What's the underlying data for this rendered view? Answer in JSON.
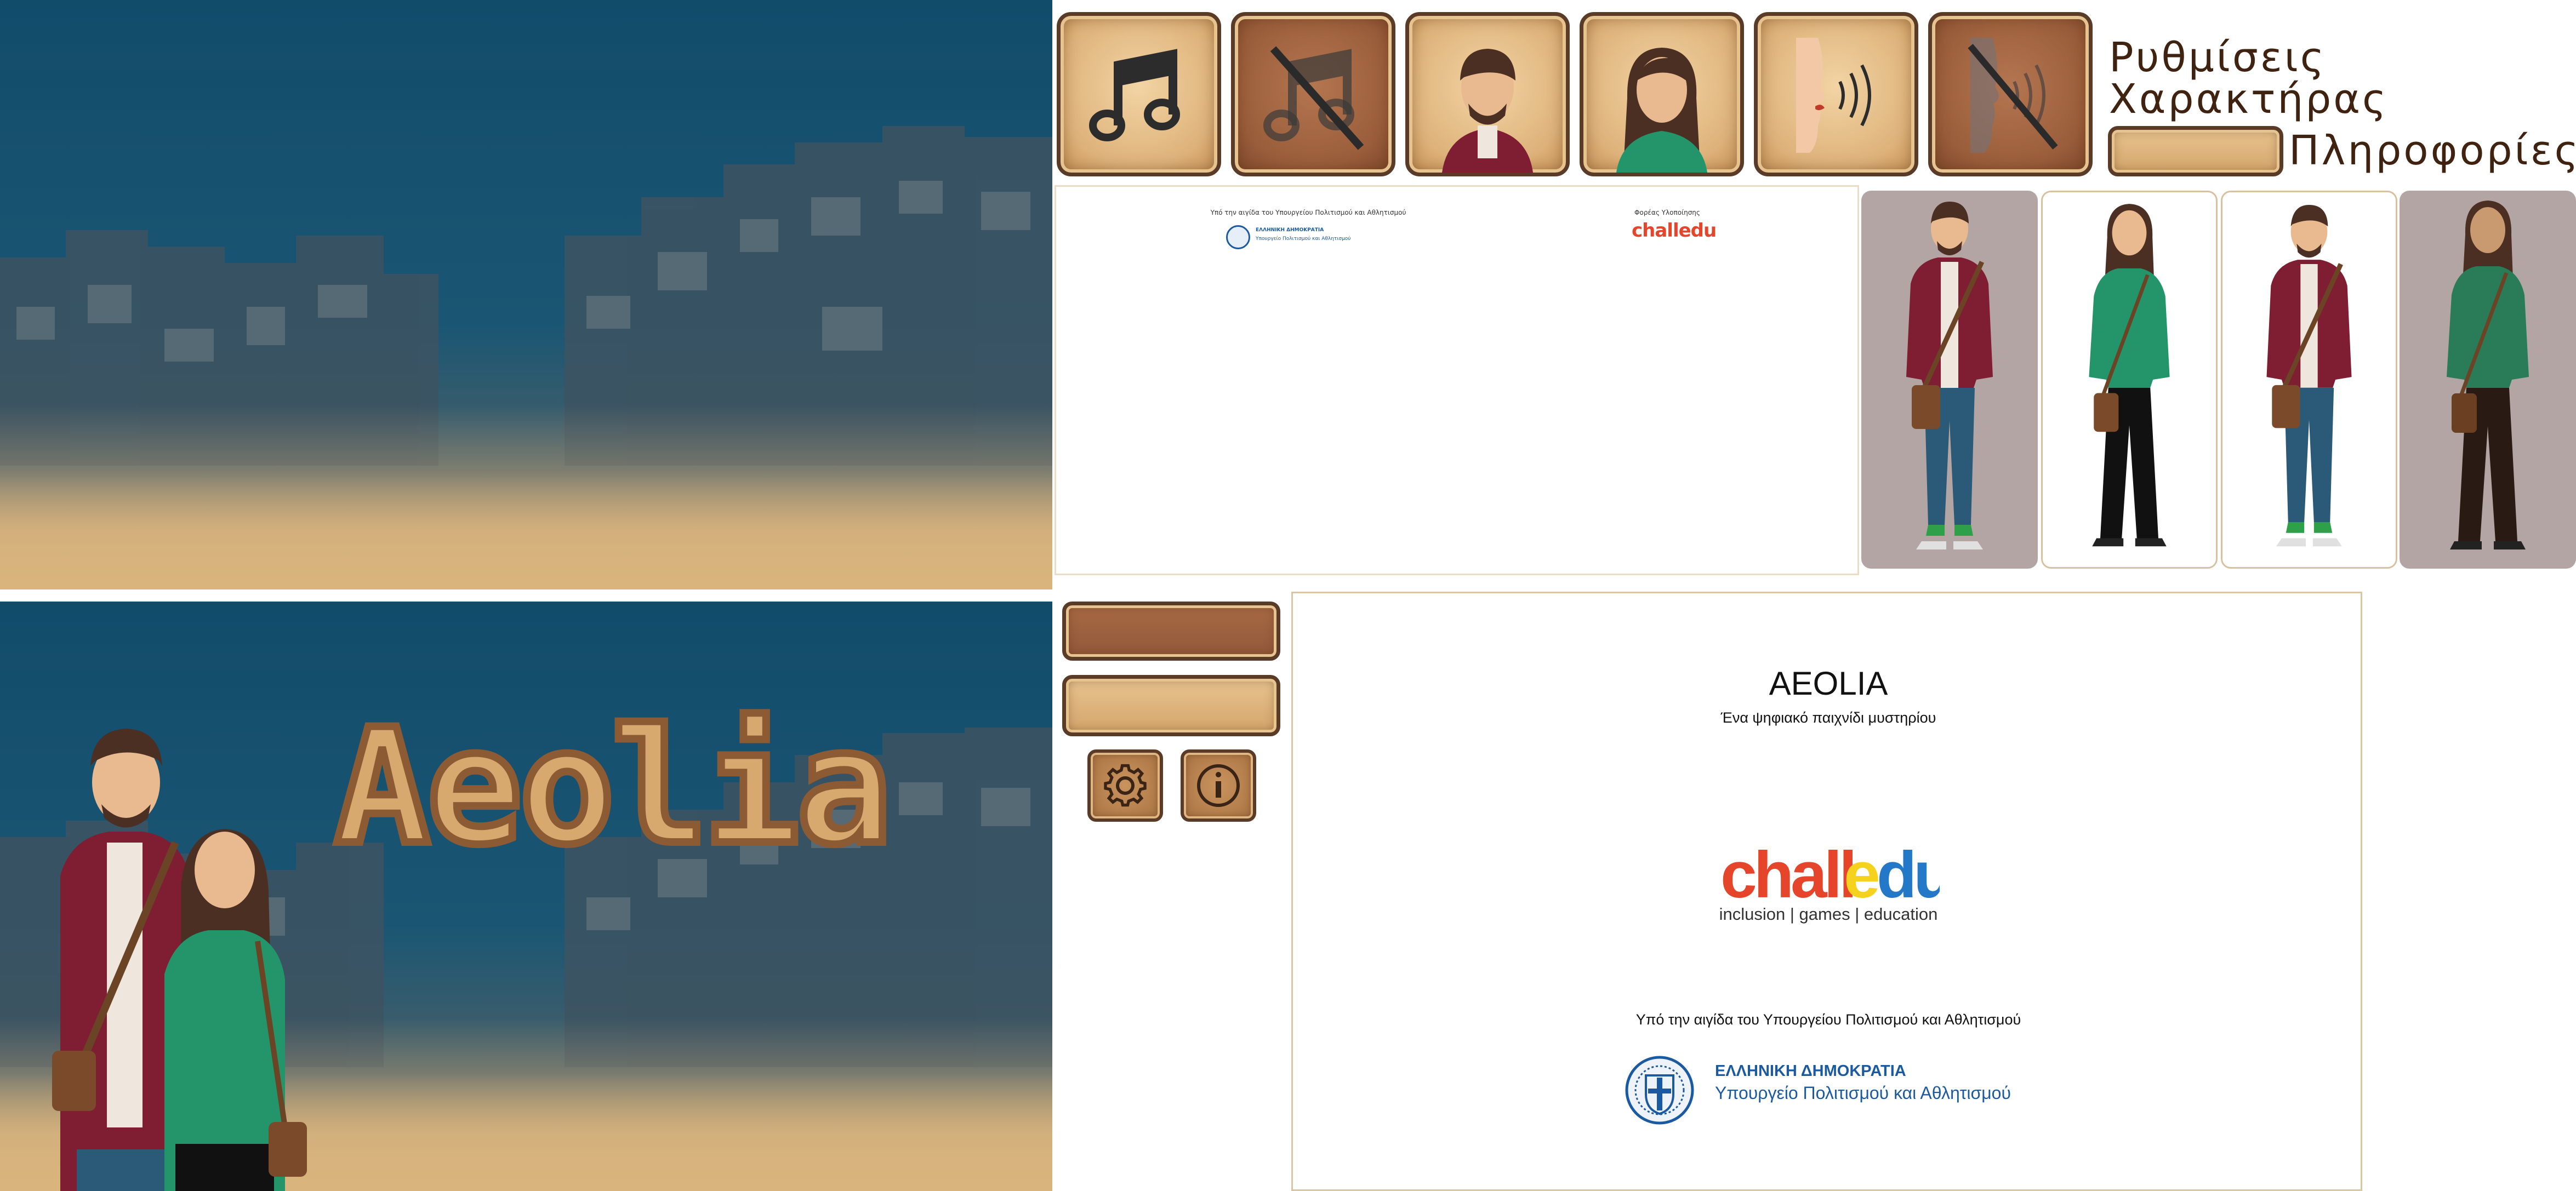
{
  "game": {
    "logo_text": "Aeolia"
  },
  "header_labels": {
    "settings": "Ρυθμίσεις",
    "characters": "Χαρακτήρας",
    "info": "Πληροφορίες"
  },
  "credits": {
    "title": "AEOLIA",
    "subtitle": "Ένα ψηφιακό παιχνίδι μυστηρίου",
    "publisher_brand": "challedu",
    "publisher_tagline": "inclusion | games | education",
    "patronage": "Υπό την αιγίδα του Υπουργείου Πολιτισμού και Αθλητισμού",
    "ministry_line1": "ΕΛΛΗΝΙΚΗ ΔΗΜΟΚΡΑΤΙΑ",
    "ministry_line2": "Υπουργείο Πολιτισμού και Αθλητισμού"
  },
  "mini_credits": {
    "patronage": "Υπό την αιγίδα του Υπουργείου Πολιτισμού και Αθλητισμού",
    "ministry_line1": "ΕΛΛΗΝΙΚΗ ΔΗΜΟΚΡΑΤΙΑ",
    "ministry_line2": "Υπουργείο Πολιτισμού και Αθλητισμού",
    "implementer": "Φορέας Υλοποίησης",
    "publisher_brand": "challedu"
  },
  "icons": {
    "music_on": "music-note-icon",
    "music_off": "music-off-icon",
    "male": "male-character-icon",
    "female": "female-character-icon",
    "voice_on": "voice-on-icon",
    "voice_off": "voice-off-icon",
    "settings": "gear-icon",
    "info": "info-icon"
  },
  "colors": {
    "sky": "#12506f",
    "sand": "#d9b47d",
    "button_light": "#deb27a",
    "button_dark": "#9a5d3b",
    "button_border": "#5a3b28",
    "label_text": "#3f2210",
    "male_shirt": "#7f1d32",
    "female_shirt": "#24956a",
    "challedu_red": "#e4452b",
    "challedu_orange": "#f39a1e",
    "challedu_yellow": "#f4d21e",
    "challedu_blue": "#2478c8",
    "ministry_blue": "#1b5aa0"
  }
}
